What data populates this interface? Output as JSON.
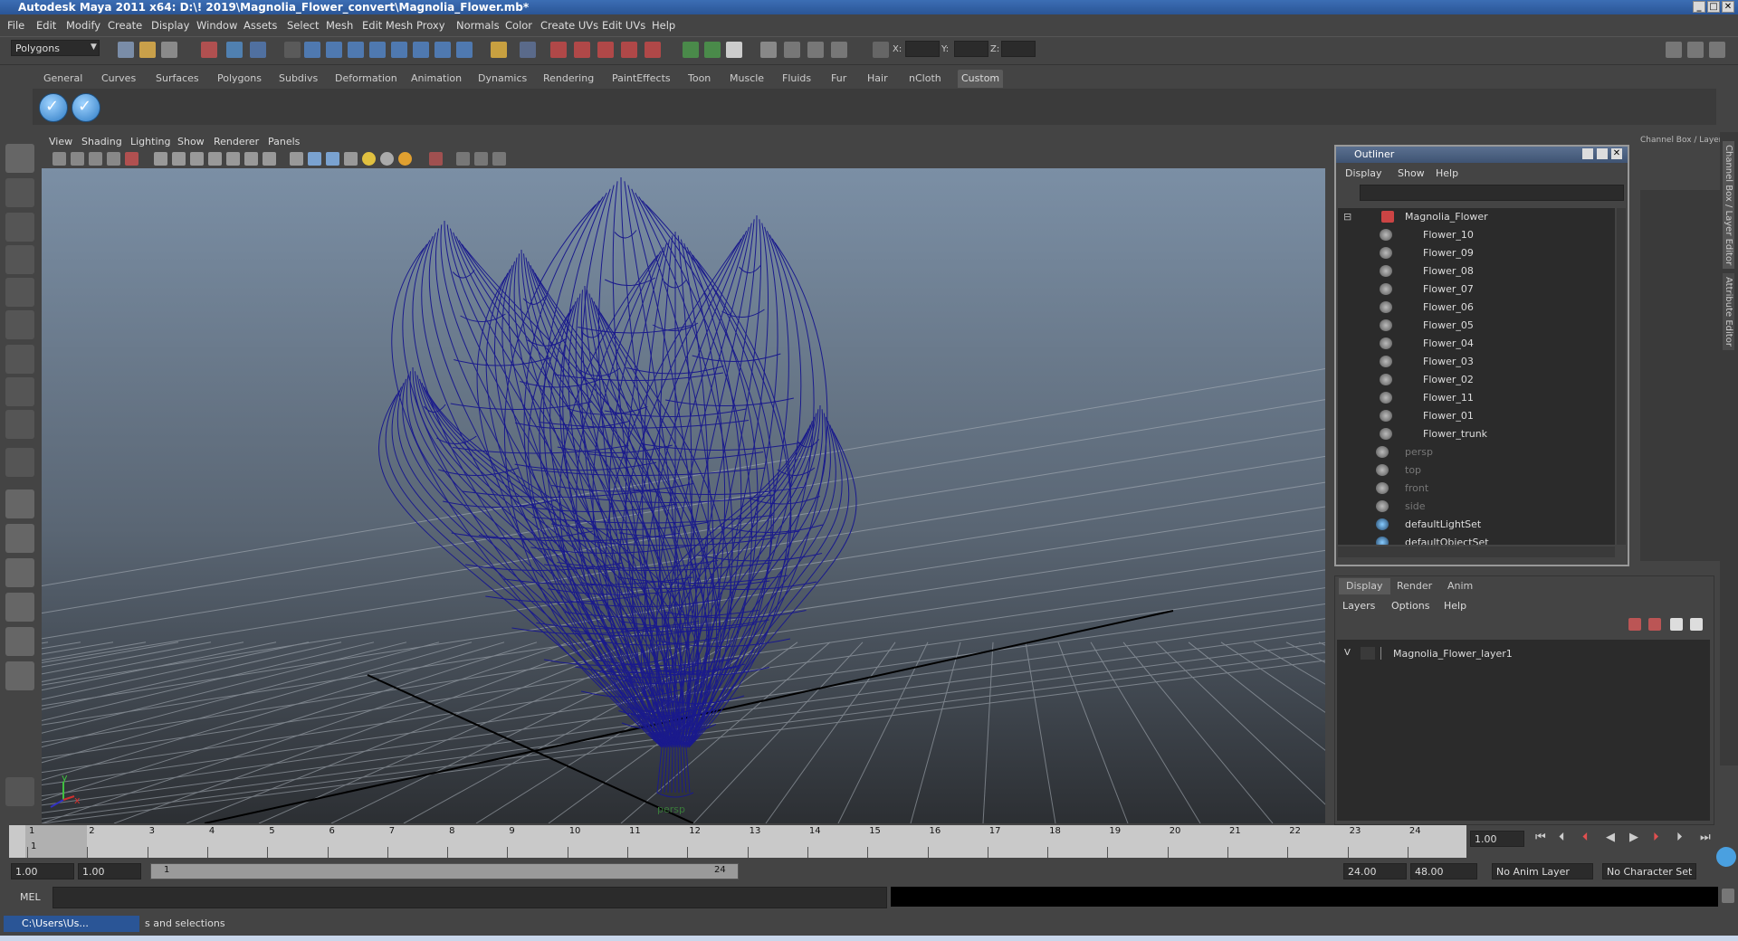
{
  "window": {
    "title": "Autodesk Maya 2011 x64: D:\\! 2019\\Magnolia_Flower_convert\\Magnolia_Flower.mb*",
    "controls": [
      "_",
      "□",
      "✕"
    ]
  },
  "menubar": [
    "File",
    "Edit",
    "Modify",
    "Create",
    "Display",
    "Window",
    "Assets",
    "Select",
    "Mesh",
    "Edit Mesh",
    "Proxy",
    "Normals",
    "Color",
    "Create UVs",
    "Edit UVs",
    "Help"
  ],
  "status_line": {
    "mode": "Polygons",
    "x_label": "X:",
    "y_label": "Y:",
    "z_label": "Z:"
  },
  "shelf": {
    "tabs": [
      "General",
      "Curves",
      "Surfaces",
      "Polygons",
      "Subdivs",
      "Deformation",
      "Animation",
      "Dynamics",
      "Rendering",
      "PaintEffects",
      "Toon",
      "Muscle",
      "Fluids",
      "Fur",
      "Hair",
      "nCloth",
      "Custom"
    ],
    "active_tab": "Custom",
    "buttons": [
      "checkmark-shelf-icon",
      "checkmark-shelf-icon"
    ]
  },
  "viewport": {
    "menu": [
      "View",
      "Shading",
      "Lighting",
      "Show",
      "Renderer",
      "Panels"
    ],
    "camera_label": "persp",
    "axis_x": "x",
    "axis_y": "y",
    "wire_color": "#1a1a8c"
  },
  "outliner": {
    "title": "Outliner",
    "menu": [
      "Display",
      "Show",
      "Help"
    ],
    "items": [
      {
        "label": "Magnolia_Flower",
        "dim": false
      },
      {
        "label": "Flower_10",
        "dim": false
      },
      {
        "label": "Flower_09",
        "dim": false
      },
      {
        "label": "Flower_08",
        "dim": false
      },
      {
        "label": "Flower_07",
        "dim": false
      },
      {
        "label": "Flower_06",
        "dim": false
      },
      {
        "label": "Flower_05",
        "dim": false
      },
      {
        "label": "Flower_04",
        "dim": false
      },
      {
        "label": "Flower_03",
        "dim": false
      },
      {
        "label": "Flower_02",
        "dim": false
      },
      {
        "label": "Flower_11",
        "dim": false
      },
      {
        "label": "Flower_01",
        "dim": false
      },
      {
        "label": "Flower_trunk",
        "dim": false
      },
      {
        "label": "persp",
        "dim": true
      },
      {
        "label": "top",
        "dim": true
      },
      {
        "label": "front",
        "dim": true
      },
      {
        "label": "side",
        "dim": true
      },
      {
        "label": "defaultLightSet",
        "dim": false
      },
      {
        "label": "defaultObjectSet",
        "dim": false
      }
    ]
  },
  "channel_box": {
    "title": "Channel Box / Layer Editor",
    "side_tabs": [
      "Channel Box / Layer Editor",
      "Attribute Editor"
    ]
  },
  "layer_editor": {
    "tabs": [
      "Display",
      "Render",
      "Anim"
    ],
    "active_tab": "Display",
    "menu": [
      "Layers",
      "Options",
      "Help"
    ],
    "layer": {
      "visible": "V",
      "name": "Magnolia_Flower_layer1"
    }
  },
  "time_slider": {
    "ticks": [
      "1",
      "2",
      "3",
      "4",
      "5",
      "6",
      "7",
      "8",
      "9",
      "10",
      "11",
      "12",
      "13",
      "14",
      "15",
      "16",
      "17",
      "18",
      "19",
      "20",
      "21",
      "22",
      "23",
      "24"
    ],
    "current_frame": "1.00",
    "current_marker": "1"
  },
  "range_slider": {
    "start_time": "1.00",
    "playback_start": "1.00",
    "range_start_label": "1",
    "range_end_label": "24",
    "playback_end": "24.00",
    "end_time": "48.00",
    "anim_layer": "No Anim Layer",
    "character_set": "No Character Set"
  },
  "command_line": {
    "label": "MEL"
  },
  "help_line": {
    "task": "C:\\Users\\Us...",
    "text": "s and selections"
  }
}
